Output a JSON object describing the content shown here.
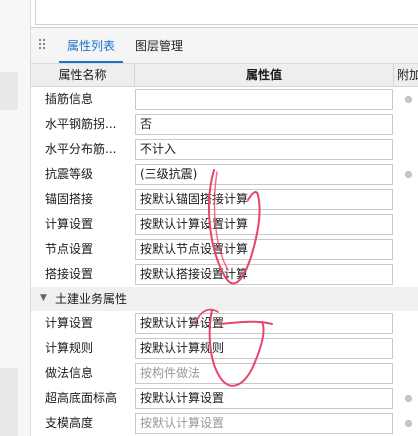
{
  "tabs": [
    {
      "label": "属性列表",
      "active": true
    },
    {
      "label": "图层管理",
      "active": false
    }
  ],
  "header": {
    "name_col": "属性名称",
    "value_col": "属性值",
    "extra_col": "附加"
  },
  "rows_top": [
    {
      "name": "插筋信息",
      "value": "",
      "muted": false,
      "dot": true
    },
    {
      "name": "水平钢筋拐...",
      "value": "否",
      "muted": false,
      "dot": false
    },
    {
      "name": "水平分布筋...",
      "value": "不计入",
      "muted": false,
      "dot": false
    },
    {
      "name": "抗震等级",
      "value": "(三级抗震)",
      "muted": false,
      "dot": true
    },
    {
      "name": "锚固搭接",
      "value": "按默认锚固搭接计算",
      "muted": false,
      "dot": false
    },
    {
      "name": "计算设置",
      "value": "按默认计算设置计算",
      "muted": false,
      "dot": false
    },
    {
      "name": "节点设置",
      "value": "按默认节点设置计算",
      "muted": false,
      "dot": false
    },
    {
      "name": "搭接设置",
      "value": "按默认搭接设置计算",
      "muted": false,
      "dot": false
    }
  ],
  "group": {
    "title": "土建业务属性"
  },
  "rows_bottom": [
    {
      "name": "计算设置",
      "value": "按默认计算设置",
      "muted": false,
      "dot": false
    },
    {
      "name": "计算规则",
      "value": "按默认计算规则",
      "muted": false,
      "dot": false
    },
    {
      "name": "做法信息",
      "value": "按构件做法",
      "muted": true,
      "dot": false
    },
    {
      "name": "超高底面标高",
      "value": "按默认计算设置",
      "muted": false,
      "dot": true
    },
    {
      "name": "支模高度",
      "value": "按默认计算设置",
      "muted": true,
      "dot": true
    }
  ],
  "colors": {
    "accent": "#1a73c9",
    "annotation": "#e8456b"
  }
}
